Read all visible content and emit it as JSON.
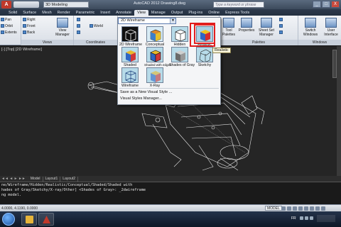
{
  "titlebar": {
    "app_letter": "A",
    "workspace": "3D Modeling",
    "title": "AutoCAD 2012   Drawing8.dwg",
    "search_placeholder": "Type a keyword or phrase",
    "min": "_",
    "max": "□",
    "close": "X"
  },
  "ribbon_tabs": [
    "Solid",
    "Surface",
    "Mesh",
    "Render",
    "Parametric",
    "Insert",
    "Annotate",
    "View",
    "Manage",
    "Output",
    "Plug-ins",
    "Online",
    "Express Tools"
  ],
  "ribbon": {
    "left_items": [
      "Pan",
      "Orbit",
      "Extents"
    ],
    "named_views": [
      "Right",
      "Front",
      "Back"
    ],
    "views_panel_title": "Views",
    "view_manager": "View Manager",
    "ucs_items": [
      "World"
    ],
    "coordinates_panel_title": "Coordinates",
    "tool_palettes": "Tool Palettes",
    "properties": "Properties",
    "sheet_set_manager": "Sheet Set Manager",
    "palettes_panel_title": "Palettes",
    "switch_windows": "Switch Windows",
    "user_interface": "User Interface",
    "windows_panel_title": "Windows"
  },
  "viewport": {
    "label": "[-] [Top] [2D Wireframe]"
  },
  "visual_styles": {
    "current": "2D Wireframe",
    "items": [
      {
        "label": "2D Wireframe"
      },
      {
        "label": "Conceptual"
      },
      {
        "label": "Hidden"
      },
      {
        "label": "Realistic"
      },
      {
        "label": "Shaded"
      },
      {
        "label": "Shaded with edges"
      },
      {
        "label": "Shades of Gray"
      },
      {
        "label": "Sketchy"
      },
      {
        "label": "Wireframe"
      },
      {
        "label": "X-Ray"
      }
    ],
    "tooltip": "Realistic",
    "save_as_new": "Save as a New Visual Style ...",
    "manager": "Visual Styles Manager..."
  },
  "layout_tabs": {
    "nav": "◄◄ ◄ ► ►►",
    "tabs": [
      "Model",
      "Layout1",
      "Layout2"
    ]
  },
  "command": {
    "lines": [
      "ne/Wireframe/Hidden/Realistic/Conceptual/Shaded/Shaded with",
      "hades of Gray/Sketchy/X-ray/Other] <Shades of Gray>: _2dwireframe",
      "ng model."
    ]
  },
  "status": {
    "coords": "4.0000, 4.1190, 0.0000",
    "model": "MODEL"
  },
  "taskbar": {
    "lang": "FR"
  },
  "colors": {
    "selection_outline": "#e11d1d",
    "viewport_bg": "#252525"
  }
}
